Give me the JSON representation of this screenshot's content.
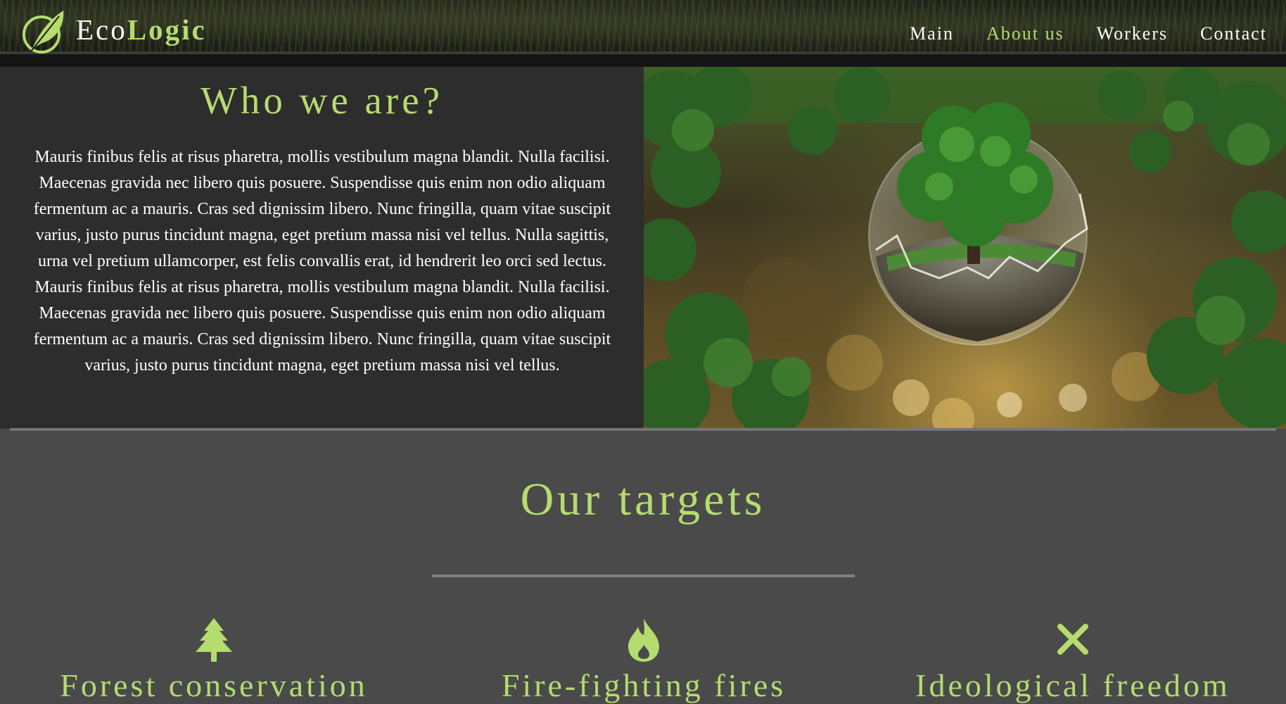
{
  "brand": {
    "name_part1": "Eco",
    "name_part2": "Logic",
    "accent_color": "#b4dc6e",
    "logo_icon": "leaf-circle-icon"
  },
  "nav": {
    "items": [
      {
        "label": "Main",
        "active": false
      },
      {
        "label": "About us",
        "active": true
      },
      {
        "label": "Workers",
        "active": false
      },
      {
        "label": "Contact",
        "active": false
      }
    ]
  },
  "about": {
    "title": "Who we are?",
    "text": "Mauris finibus felis at risus pharetra, mollis vestibulum magna blandit. Nulla facilisi. Maecenas gravida nec libero quis posuere. Suspendisse quis enim non odio aliquam fermentum ac a mauris. Cras sed dignissim libero. Nunc fringilla, quam vitae suscipit varius, justo purus tincidunt magna, eget pretium massa nisi vel tellus. Nulla sagittis, urna vel pretium ullamcorper, est felis convallis erat, id hendrerit leo orci sed lectus. Mauris finibus felis at risus pharetra, mollis vestibulum magna blandit. Nulla facilisi. Maecenas gravida nec libero quis posuere. Suspendisse quis enim non odio aliquam fermentum ac a mauris. Cras sed dignissim libero. Nunc fringilla, quam vitae suscipit varius, justo purus tincidunt magna, eget pretium massa nisi vel tellus."
  },
  "targets": {
    "title": "Our targets",
    "items": [
      {
        "icon": "tree-icon",
        "label": "Forest conservation"
      },
      {
        "icon": "fire-icon",
        "label": "Fire-fighting fires"
      },
      {
        "icon": "close-icon",
        "label": "Ideological freedom"
      }
    ]
  }
}
